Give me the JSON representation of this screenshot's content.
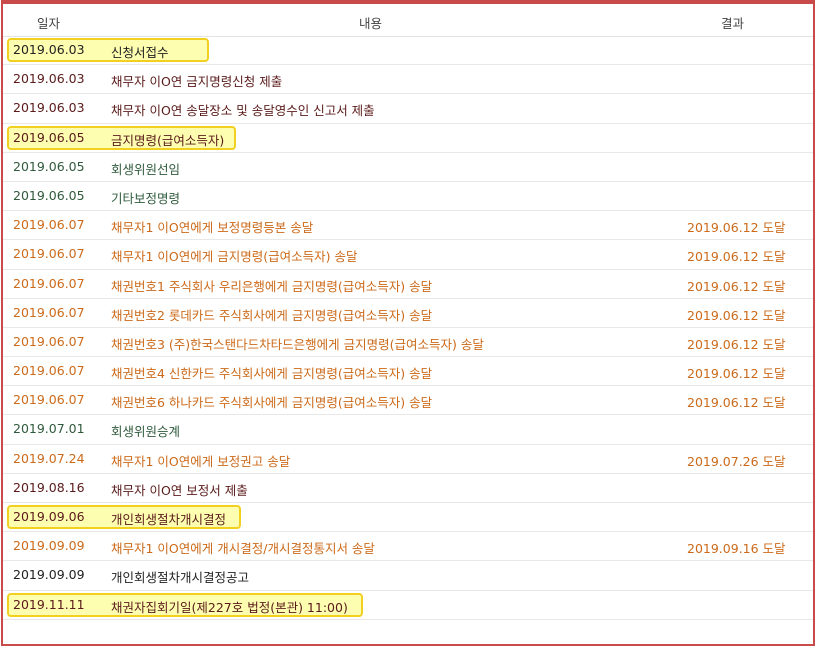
{
  "header": {
    "date": "일자",
    "content": "내용",
    "result": "결과"
  },
  "rows": [
    {
      "date": "2019.06.03",
      "content": "신청서접수",
      "result": "",
      "color": "#222222",
      "highlight": true,
      "hlw": 202
    },
    {
      "date": "2019.06.03",
      "content": "채무자 이O연 금지명령신청 제출",
      "result": "",
      "color": "#5a1a1a",
      "highlight": false
    },
    {
      "date": "2019.06.03",
      "content": "채무자 이O연 송달장소 및 송달영수인 신고서 제출",
      "result": "",
      "color": "#5a1a1a",
      "highlight": false
    },
    {
      "date": "2019.06.05",
      "content": "금지명령(급여소득자)",
      "result": "",
      "color": "#5a1a1a",
      "highlight": true,
      "hlw": 229
    },
    {
      "date": "2019.06.05",
      "content": "회생위원선임",
      "result": "",
      "color": "#2f5a3c",
      "highlight": false
    },
    {
      "date": "2019.06.05",
      "content": "기타보정명령",
      "result": "",
      "color": "#2f5a3c",
      "highlight": false
    },
    {
      "date": "2019.06.07",
      "content": "채무자1 이O연에게 보정명령등본 송달",
      "result": "2019.06.12 도달",
      "color": "#cc6a1a",
      "highlight": false
    },
    {
      "date": "2019.06.07",
      "content": "채무자1 이O연에게 금지명령(급여소득자) 송달",
      "result": "2019.06.12 도달",
      "color": "#cc6a1a",
      "highlight": false
    },
    {
      "date": "2019.06.07",
      "content": "채권번호1 주식회사 우리은행에게 금지명령(급여소득자) 송달",
      "result": "2019.06.12 도달",
      "color": "#cc6a1a",
      "highlight": false
    },
    {
      "date": "2019.06.07",
      "content": "채권번호2 롯데카드 주식회사에게 금지명령(급여소득자) 송달",
      "result": "2019.06.12 도달",
      "color": "#cc6a1a",
      "highlight": false
    },
    {
      "date": "2019.06.07",
      "content": "채권번호3 (주)한국스탠다드차타드은행에게 금지명령(급여소득자) 송달",
      "result": "2019.06.12 도달",
      "color": "#cc6a1a",
      "highlight": false
    },
    {
      "date": "2019.06.07",
      "content": "채권번호4 신한카드 주식회사에게 금지명령(급여소득자) 송달",
      "result": "2019.06.12 도달",
      "color": "#cc6a1a",
      "highlight": false
    },
    {
      "date": "2019.06.07",
      "content": "채권번호6 하나카드 주식회사에게 금지명령(급여소득자) 송달",
      "result": "2019.06.12 도달",
      "color": "#cc6a1a",
      "highlight": false
    },
    {
      "date": "2019.07.01",
      "content": "회생위원승계",
      "result": "",
      "color": "#2f5a3c",
      "highlight": false
    },
    {
      "date": "2019.07.24",
      "content": "채무자1 이O연에게 보정권고 송달",
      "result": "2019.07.26 도달",
      "color": "#cc6a1a",
      "highlight": false
    },
    {
      "date": "2019.08.16",
      "content": "채무자 이O연 보정서 제출",
      "result": "",
      "color": "#5a1a1a",
      "highlight": false
    },
    {
      "date": "2019.09.06",
      "content": "개인회생절차개시결정",
      "result": "",
      "color": "#5a1a1a",
      "highlight": true,
      "hlw": 234
    },
    {
      "date": "2019.09.09",
      "content": "채무자1 이O연에게 개시결정/개시결정통지서 송달",
      "result": "2019.09.16 도달",
      "color": "#cc6a1a",
      "highlight": false
    },
    {
      "date": "2019.09.09",
      "content": "개인회생절차개시결정공고",
      "result": "",
      "color": "#222222",
      "highlight": false
    },
    {
      "date": "2019.11.11",
      "content": "채권자집회기일(제227호 법정(본관) 11:00)",
      "result": "",
      "color": "#5a1a1a",
      "highlight": true,
      "hlw": 356
    }
  ]
}
